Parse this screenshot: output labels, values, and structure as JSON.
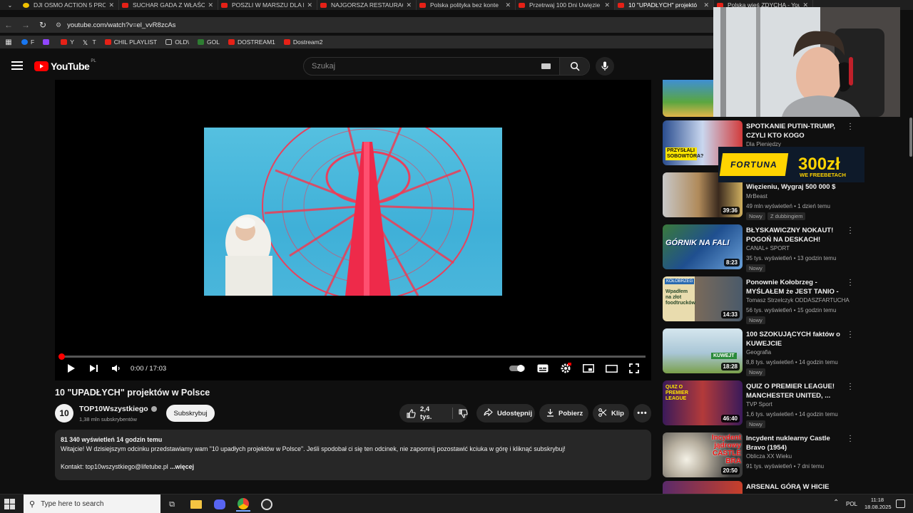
{
  "browser": {
    "tabs": [
      {
        "title": "DJI OSMO ACTION 5 PRO",
        "active": false
      },
      {
        "title": "SUCHAR GADA Z WŁAŚCI",
        "active": false
      },
      {
        "title": "POSZLI W MARSZU DLA P",
        "active": false
      },
      {
        "title": "NAJGORSZA RESTAURAC",
        "active": false
      },
      {
        "title": "Polska polityka bez konte",
        "active": false
      },
      {
        "title": "Przetrwaj 100 Dni Uwięzie",
        "active": false
      },
      {
        "title": "10 \"UPADŁYCH\" projektó",
        "active": true
      },
      {
        "title": "Polska wieś ZDYCHA - You",
        "active": false
      }
    ],
    "url": "youtube.com/watch?v=el_vvR8zcAs",
    "bookmarks": [
      {
        "label": "F",
        "icon": "facebook-icon"
      },
      {
        "label": "",
        "icon": "twitch-icon"
      },
      {
        "label": "Y",
        "icon": "youtube-icon"
      },
      {
        "label": "T",
        "icon": "x-icon"
      },
      {
        "label": "CHIL PLAYLIST",
        "icon": "youtube-icon"
      },
      {
        "label": "OLD\\",
        "icon": "folder-icon"
      },
      {
        "label": "GOL",
        "icon": "gol-icon"
      },
      {
        "label": "DOSTREAM1",
        "icon": "youtube-icon"
      },
      {
        "label": "Dostream2",
        "icon": "youtube-icon"
      }
    ]
  },
  "youtube": {
    "logo_text": "YouTube",
    "country_code": "PL",
    "search_placeholder": "Szukaj"
  },
  "player": {
    "time": "0:00 / 17:03",
    "progress": 0.0
  },
  "video": {
    "title": "10 \"UPADŁYCH\" projektów w Polsce",
    "channel": "TOP10Wszystkiego",
    "channel_avatar_text": "10",
    "subscribers": "1,38 mln subskrybentów",
    "subscribe_label": "Subskrybuj",
    "likes": "2,4 tys.",
    "share_label": "Udostępnij",
    "download_label": "Pobierz",
    "clip_label": "Klip",
    "description": {
      "stats": "81 340 wyświetleń  14 godzin temu",
      "line1": "Witajcie! W dzisiejszym odcinku przedstawiamy wam \"10 upadłych projektów w Polsce\". Jeśli spodobał ci się ten odcinek, nie zapomnij pozostawić kciuka w górę i kliknąć subskrybuj!",
      "contact": "Kontakt: top10wszystkiego@lifetube.pl",
      "more": "...więcej"
    }
  },
  "recommendations": [
    {
      "title": "SPOTKANIE PUTIN-TRUMP, CZYLI KTO KOGO ROZEGRAŁ?...",
      "channel": "Dla Pieniędzy",
      "meta": "",
      "duration": "",
      "badges": []
    },
    {
      "title": "Więzieniu, Wygraj 500 000 $",
      "channel": "MrBeast",
      "meta": "49 mln wyświetleń • 1 dzień temu",
      "duration": "39:36",
      "badges": [
        "Nowy",
        "Z dubbingiem"
      ]
    },
    {
      "title": "BŁYSKAWICZNY NOKAUT! POGOŃ NA DESKACH! POGOŃ...",
      "channel": "CANAL+ SPORT",
      "meta": "35 tys. wyświetleń • 13 godzin temu",
      "duration": "8:23",
      "badges": [
        "Nowy"
      ]
    },
    {
      "title": "Ponownie Kołobrzeg - MYŚLAŁEM że JEST  TANIO - ...",
      "channel": "Tomasz Strzelczyk ODDASZFARTUCHA",
      "meta": "56 tys. wyświetleń • 15 godzin temu",
      "duration": "14:33",
      "badges": [
        "Nowy"
      ]
    },
    {
      "title": "100 SZOKUJĄCYCH faktów o KUWEJCIE",
      "channel": "Geografia",
      "meta": "8,8 tys. wyświetleń • 14 godzin temu",
      "duration": "18:28",
      "badges": [
        "Nowy"
      ]
    },
    {
      "title": "QUIZ O PREMIER LEAGUE! MANCHESTER UNITED, ...",
      "channel": "TVP Sport",
      "meta": "1,6 tys. wyświetleń • 14 godzin temu",
      "duration": "46:40",
      "badges": [
        "Nowy"
      ]
    },
    {
      "title": "Incydent nuklearny Castle Bravo (1954)",
      "channel": "Oblicza XX Wieku",
      "meta": "91 tys. wyświetleń • 7 dni temu",
      "duration": "20:50",
      "badges": []
    },
    {
      "title": "ARSENAL GÓRĄ W HICIE",
      "channel": "",
      "meta": "",
      "duration": "",
      "badges": []
    }
  ],
  "thumb_texts": {
    "t0": "PRZYSŁALI SOBOWTÓRA?",
    "t2": "GÓRNIK NA FALI",
    "t3": "Wpadłem na złot foodtrucków",
    "t3_top": "KOŁOBRZEG",
    "t4": "KUWEJT",
    "t5": "QUIZ O PREMIER LEAGUE",
    "t6": "Incydent jądrowy CASTLE BRA"
  },
  "ad": {
    "brand": "FORTUNA",
    "amount": "300zł",
    "sub": "WE FREEBETACH"
  },
  "taskbar": {
    "search_placeholder": "Type here to search",
    "language": "POL",
    "time": "11:18",
    "date": "18.08.2025"
  },
  "colors": {
    "yt_red": "#ff0000",
    "bg": "#0f0f0f",
    "pill_bg": "#272727",
    "fortuna_yellow": "#ffd400"
  }
}
